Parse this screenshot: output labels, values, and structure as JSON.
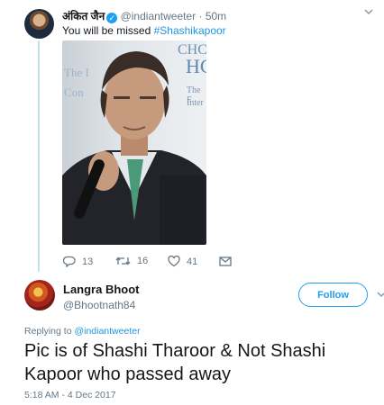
{
  "original_tweet": {
    "author_name": "अंकित जैन",
    "handle": "@indiantweeter",
    "separator": "·",
    "time_ago": "50m",
    "text_prefix": "You will be missed ",
    "hashtag": "#Shashikapoor",
    "photo_background_text": [
      "The I",
      "Con",
      "CHC",
      "HC",
      "The F",
      "Inter"
    ],
    "actions": {
      "replies": "13",
      "retweets": "16",
      "likes": "41"
    }
  },
  "reply_tweet": {
    "author_name": "Langra Bhoot",
    "handle": "@Bhootnath84",
    "follow_label": "Follow",
    "replying_prefix": "Replying to ",
    "replying_to": "@indiantweeter",
    "text": "Pic is of Shashi Tharoor & Not Shashi Kapoor who passed away",
    "timestamp": "5:18 AM - 4 Dec 2017"
  },
  "colors": {
    "accent": "#1da1f2",
    "link": "#1b95e0",
    "muted": "#657786",
    "text": "#14171a"
  },
  "icons": [
    "verified-icon",
    "reply-icon",
    "retweet-icon",
    "like-icon",
    "dm-icon",
    "chevron-down-icon"
  ]
}
